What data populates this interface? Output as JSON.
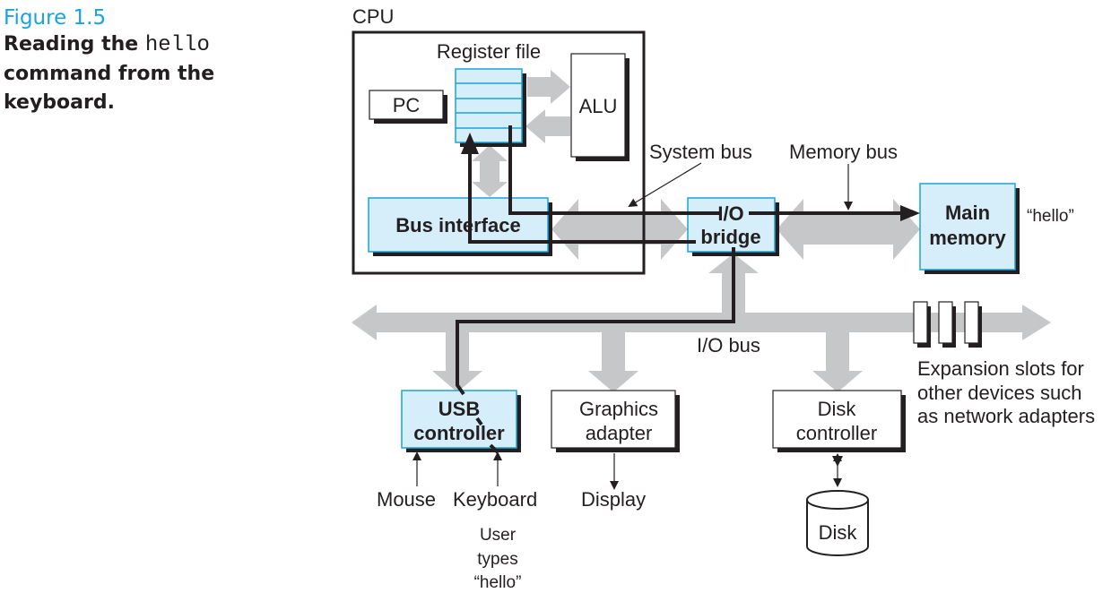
{
  "caption": {
    "figure_number": "Figure 1.5",
    "title_before": "Reading the ",
    "title_code": "hello",
    "title_line2": "command from the",
    "title_line3": "keyboard."
  },
  "diagram": {
    "cpu_label": "CPU",
    "register_file_label": "Register file",
    "pc_label": "PC",
    "alu_label": "ALU",
    "bus_interface_label": "Bus interface",
    "system_bus_label": "System bus",
    "memory_bus_label": "Memory bus",
    "io_bridge_line1": "I/O",
    "io_bridge_line2": "bridge",
    "main_memory_line1": "Main",
    "main_memory_line2": "memory",
    "memory_contents": "“hello”",
    "io_bus_label": "I/O bus",
    "usb_line1": "USB",
    "usb_line2": "controller",
    "graphics_line1": "Graphics",
    "graphics_line2": "adapter",
    "disk_ctrl_line1": "Disk",
    "disk_ctrl_line2": "controller",
    "expansion_line1": "Expansion slots for",
    "expansion_line2": "other devices such",
    "expansion_line3": "as network adapters",
    "mouse_label": "Mouse",
    "keyboard_label": "Keyboard",
    "display_label": "Display",
    "disk_label": "Disk",
    "user_line1": "User",
    "user_line2": "types",
    "user_line3": "“hello”",
    "colors": {
      "box_fill_highlight": "#d5eef9",
      "box_stroke_highlight": "#1aa3d9",
      "bus_gray": "#c6c7c8",
      "ink": "#231f20",
      "caption_blue": "#1aa3d9"
    }
  }
}
